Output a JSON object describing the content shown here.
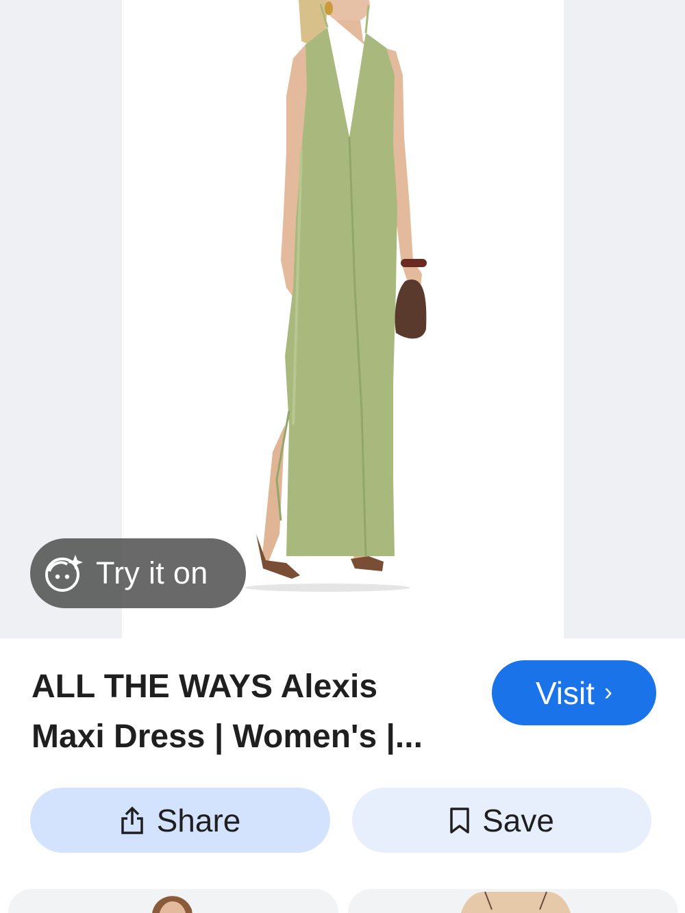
{
  "product": {
    "image_icon": "green-halter-maxi-dress-photo",
    "try_on": {
      "label": "Try it on",
      "icon": "face-sparkle-icon"
    },
    "title_lines": [
      "ALL THE WAYS Alexis",
      "Maxi Dress | Women's |..."
    ],
    "visit": {
      "label": "Visit",
      "icon": "chevron-right-icon"
    }
  },
  "actions": {
    "share": {
      "label": "Share",
      "icon": "share-icon"
    },
    "save": {
      "label": "Save",
      "icon": "bookmark-icon"
    }
  },
  "related": [
    {
      "icon": "model-thumbnail"
    },
    {
      "icon": "dress-thumbnail"
    }
  ],
  "colors": {
    "accent": "#1a73e8",
    "share_bg": "#d3e3fd",
    "save_bg": "#e8effc",
    "dress": "#a9b97e"
  }
}
